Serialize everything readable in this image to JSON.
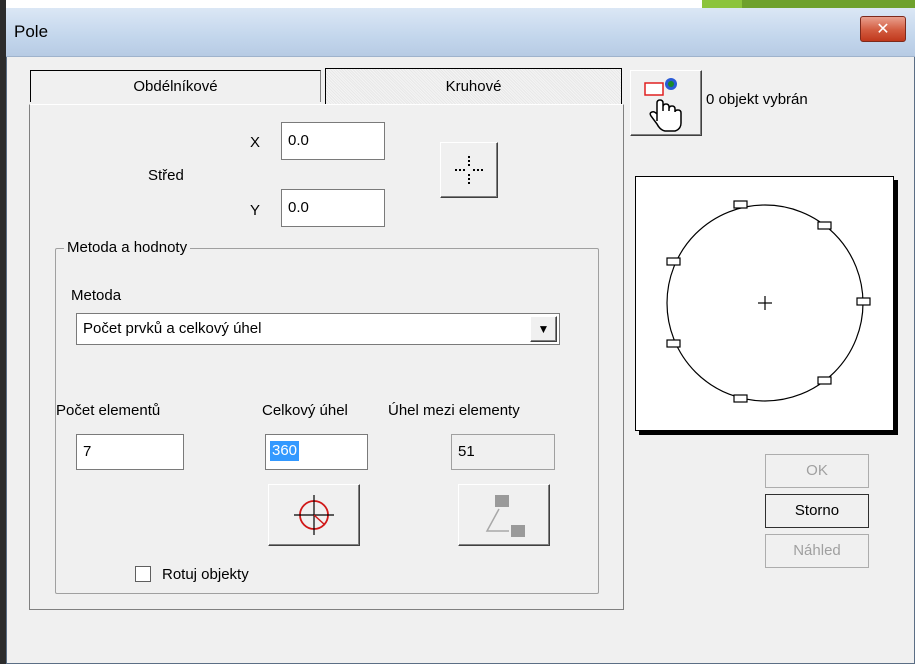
{
  "window": {
    "title": "Pole",
    "close_label": "✕"
  },
  "tabs": [
    {
      "label": "Obdélníkové",
      "active": false
    },
    {
      "label": "Kruhové",
      "active": true
    }
  ],
  "selection": {
    "status": "0 objekt vybrán",
    "icon": "pick-object-hand-icon"
  },
  "center": {
    "label": "Střed",
    "x_label": "X",
    "x_value": "0.0",
    "y_label": "Y",
    "y_value": "0.0",
    "pick_icon": "pick-point-crosshair-icon"
  },
  "method_group": {
    "title": "Metoda a hodnoty",
    "method_label": "Metoda",
    "method_value": "Počet prvků a celkový úhel",
    "count_label": "Počet elementů",
    "count_value": "7",
    "total_angle_label": "Celkový úhel",
    "total_angle_value": "360",
    "between_label": "Úhel mezi elementy",
    "between_value": "51",
    "rotate_label": "Rotuj objekty",
    "rotate_checked": false
  },
  "buttons": {
    "ok": "OK",
    "cancel": "Storno",
    "preview": "Náhled"
  },
  "colors": {
    "accent_red": "#e02020",
    "title_gradient": "#c3d6ec",
    "close_red": "#c0381c"
  }
}
